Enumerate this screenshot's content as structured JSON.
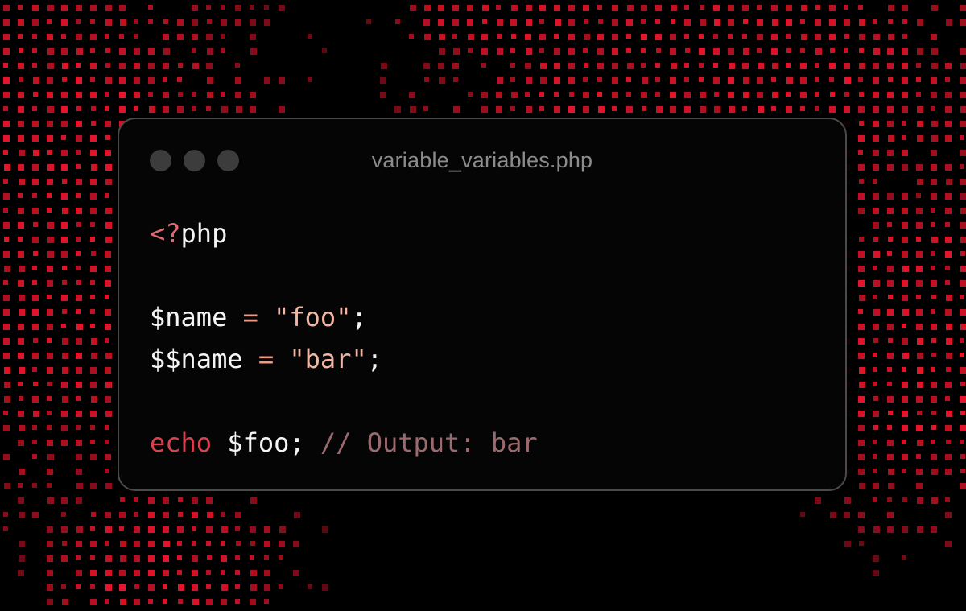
{
  "window": {
    "filename": "variable_variables.php",
    "controls": [
      "close",
      "minimize",
      "maximize"
    ]
  },
  "code": {
    "lines": [
      [
        {
          "t": "<?",
          "k": "tag"
        },
        {
          "t": "php",
          "k": "plain"
        }
      ],
      [],
      [
        {
          "t": "$name",
          "k": "plain"
        },
        {
          "t": " = ",
          "k": "op"
        },
        {
          "t": "\"foo\"",
          "k": "str"
        },
        {
          "t": ";",
          "k": "plain"
        }
      ],
      [
        {
          "t": "$$name",
          "k": "plain"
        },
        {
          "t": " = ",
          "k": "op"
        },
        {
          "t": "\"bar\"",
          "k": "str"
        },
        {
          "t": ";",
          "k": "plain"
        }
      ],
      [],
      [
        {
          "t": "echo",
          "k": "kw"
        },
        {
          "t": " $foo; ",
          "k": "plain"
        },
        {
          "t": "// Output: bar",
          "k": "comment"
        }
      ]
    ]
  },
  "colors": {
    "background": "#000000",
    "window_bg": "#050505",
    "window_border": "#4a4a4a",
    "traffic_light": "#3c3c3c",
    "accent_red": "#e8142a"
  }
}
